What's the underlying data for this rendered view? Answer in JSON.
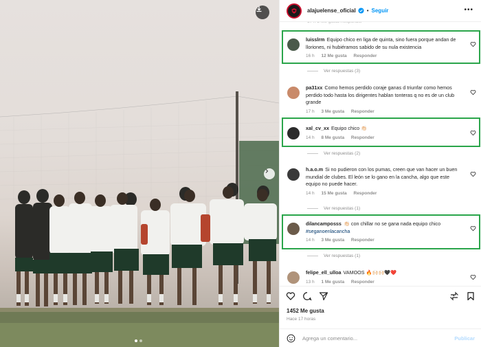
{
  "post": {
    "username": "alajuelense_oficial",
    "separator": "•",
    "follow_label": "Seguir",
    "more_label": "•••",
    "faded_meta": "17 h    2 Me gusta    Responder"
  },
  "comments": [
    {
      "user": "luisslrm",
      "text": "Equipo chico en liga de quinta, sino fuera porque andan de lloriones, ni hubiéramos sabido de su nula existencia",
      "time": "16 h",
      "likes": "12 Me gusta",
      "reply": "Responder",
      "view_replies": "Ver respuestas (3)",
      "avatar_color": "#4a5a4a",
      "highlighted": true
    },
    {
      "user": "pa31xx",
      "text": "Como hemos perdido coraje ganas d triunfar como hemos perdido todo hasta los dirigentes hablan tonteras q no es de un club grande",
      "time": "17 h",
      "likes": "3 Me gusta",
      "reply": "Responder",
      "view_replies": "",
      "avatar_color": "#c98a6a",
      "highlighted": false
    },
    {
      "user": "xal_cv_xx",
      "text": "Equipo chico 👏🏻",
      "time": "14 h",
      "likes": "8 Me gusta",
      "reply": "Responder",
      "view_replies": "Ver respuestas (2)",
      "avatar_color": "#2b2b2b",
      "highlighted": true
    },
    {
      "user": "h.a.o.m",
      "text": "Si no pudieron con los pumas, creen que van hacer un buen mundial de clubes. El león se lo gano en la cancha, algo que este equipo no puede hacer.",
      "time": "14 h",
      "likes": "15 Me gusta",
      "reply": "Responder",
      "view_replies": "Ver respuestas (1)",
      "avatar_color": "#3a3a3a",
      "highlighted": false
    },
    {
      "user": "dilancamposss",
      "text": "👏🏻 con chillar no se gana nada equipo chico",
      "hashtag": "#seganoenlacancha",
      "time": "14 h",
      "likes": "3 Me gusta",
      "reply": "Responder",
      "view_replies": "Ver respuestas (1)",
      "avatar_color": "#6b5b4a",
      "highlighted": true
    },
    {
      "user": "felipe_ell_ulloa",
      "text": "VAMOOS 🔥🙌🏻🙌🏻🖤❤️",
      "time": "13 h",
      "likes": "1 Me gusta",
      "reply": "Responder",
      "view_replies": "",
      "avatar_color": "#b0937a",
      "highlighted": false
    }
  ],
  "footer": {
    "likes": "1452 Me gusta",
    "time": "Hace 17 horas",
    "comment_placeholder": "Agrega un comentario...",
    "publish_label": "Publicar"
  },
  "colors": {
    "highlight": "#2aa54a",
    "link": "#0095f6",
    "brand_red": "#c8102e"
  },
  "icons": [
    "download-icon",
    "chevron-right-icon",
    "verified-badge-icon",
    "heart-icon",
    "comment-icon",
    "share-icon",
    "repost-icon",
    "bookmark-icon",
    "emoji-icon"
  ]
}
